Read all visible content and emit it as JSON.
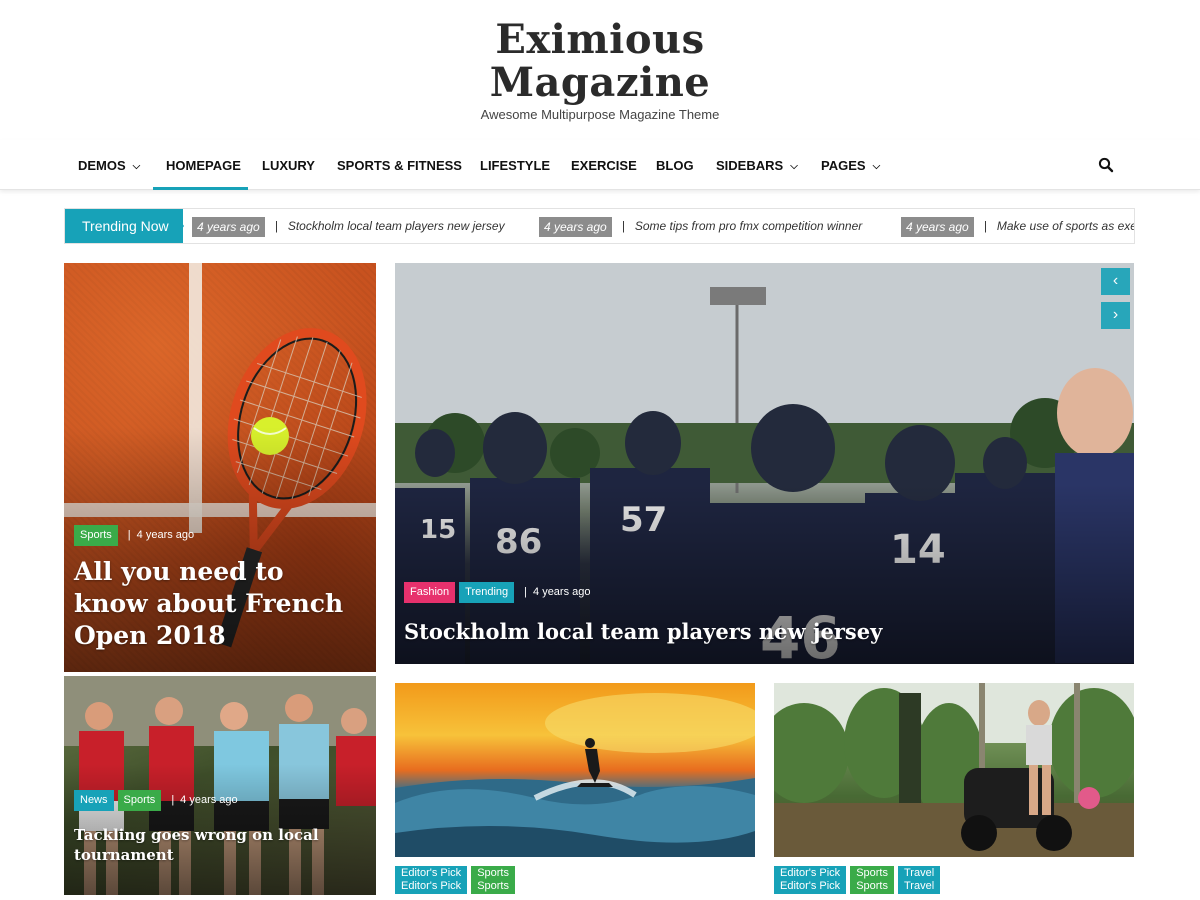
{
  "site": {
    "title_line1": "Eximious",
    "title_line2": "Magazine",
    "tagline": "Awesome Multipurpose Magazine Theme"
  },
  "nav": {
    "items": [
      {
        "label": "DEMOS",
        "has_dropdown": true
      },
      {
        "label": "HOMEPAGE",
        "active": true
      },
      {
        "label": "LUXURY"
      },
      {
        "label": "SPORTS & FITNESS"
      },
      {
        "label": "LIFESTYLE"
      },
      {
        "label": "EXERCISE"
      },
      {
        "label": "BLOG"
      },
      {
        "label": "SIDEBARS",
        "has_dropdown": true
      },
      {
        "label": "PAGES",
        "has_dropdown": true
      }
    ],
    "search_icon": "search-icon"
  },
  "trending": {
    "label": "Trending Now",
    "items": [
      {
        "time": "4 years ago",
        "title": "Stockholm local team players new jersey"
      },
      {
        "time": "4 years ago",
        "title": "Some tips from pro fmx competition winner"
      },
      {
        "time": "4 years ago",
        "title": "Make use of sports as exer"
      }
    ]
  },
  "colors": {
    "accent": "#17a2b8",
    "tag_green": "#3aab49",
    "tag_pink": "#e7316d"
  },
  "cards": {
    "tennis": {
      "tags": [
        "Sports"
      ],
      "time": "4 years ago",
      "title": "All you need to know about French Open 2018"
    },
    "rugby": {
      "tags": [
        "News",
        "Sports"
      ],
      "time": "4 years ago",
      "title": "Tackling goes wrong on local tournament"
    },
    "hero": {
      "tags": [
        "Fashion",
        "Trending"
      ],
      "time": "4 years ago",
      "title": "Stockholm local team players new jersey",
      "prev": "‹",
      "next": "›"
    },
    "surf": {
      "tags": [
        {
          "top": "Editor's Pick",
          "bottom": "Editor's Pick"
        },
        {
          "top": "Sports",
          "bottom": "Sports"
        }
      ]
    },
    "jungle": {
      "tags": [
        {
          "top": "Editor's Pick",
          "bottom": "Editor's Pick"
        },
        {
          "top": "Sports",
          "bottom": "Sports"
        },
        {
          "top": "Travel",
          "bottom": "Travel"
        }
      ]
    }
  }
}
